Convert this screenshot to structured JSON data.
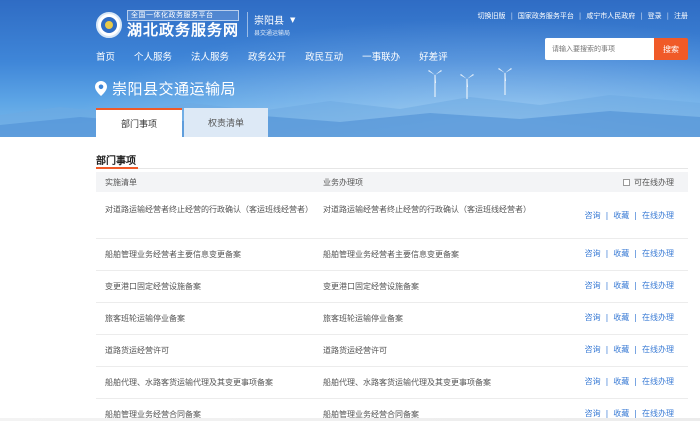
{
  "header": {
    "logo_small": "全国一体化政务服务平台",
    "logo_big": "湖北政务服务网",
    "region": "崇阳县",
    "region_sub": "县交通运输局",
    "top_links": [
      "切换旧版",
      "国家政务服务平台",
      "咸宁市人民政府",
      "登录",
      "注册"
    ],
    "nav": [
      "首页",
      "个人服务",
      "法人服务",
      "政务公开",
      "政民互动",
      "一事联办",
      "好差评"
    ],
    "search_placeholder": "请输入要搜索的事项",
    "search_button": "搜索"
  },
  "department": {
    "name": "崇阳县交通运输局",
    "tabs": [
      "部门事项",
      "权责清单"
    ]
  },
  "section": {
    "title": "部门事项",
    "col1": "实施清单",
    "col2": "业务办理项",
    "online_filter": "可在线办理"
  },
  "actions": [
    "咨询",
    "收藏",
    "在线办理"
  ],
  "rows": [
    {
      "item": "对道路运输经营者终止经营的行政确认（客运班线经营者）",
      "service": "对道路运输经营者终止经营的行政确认（客运班线经营者）"
    },
    {
      "item": "船舶管理业务经营者主要信息变更备案",
      "service": "船舶管理业务经营者主要信息变更备案"
    },
    {
      "item": "变更港口固定经营设施备案",
      "service": "变更港口固定经营设施备案"
    },
    {
      "item": "旅客班轮运输停业备案",
      "service": "旅客班轮运输停业备案"
    },
    {
      "item": "道路货运经营许可",
      "service": "道路货运经营许可"
    },
    {
      "item": "船舶代理、水路客货运输代理及其变更事项备案",
      "service": "船舶代理、水路客货运输代理及其变更事项备案"
    },
    {
      "item": "船舶管理业务经营合同备案",
      "service": "船舶管理业务经营合同备案"
    }
  ],
  "colors": {
    "accent": "#f05a28",
    "link": "#3a7bd5",
    "header_blue": "#2f6cc4"
  }
}
